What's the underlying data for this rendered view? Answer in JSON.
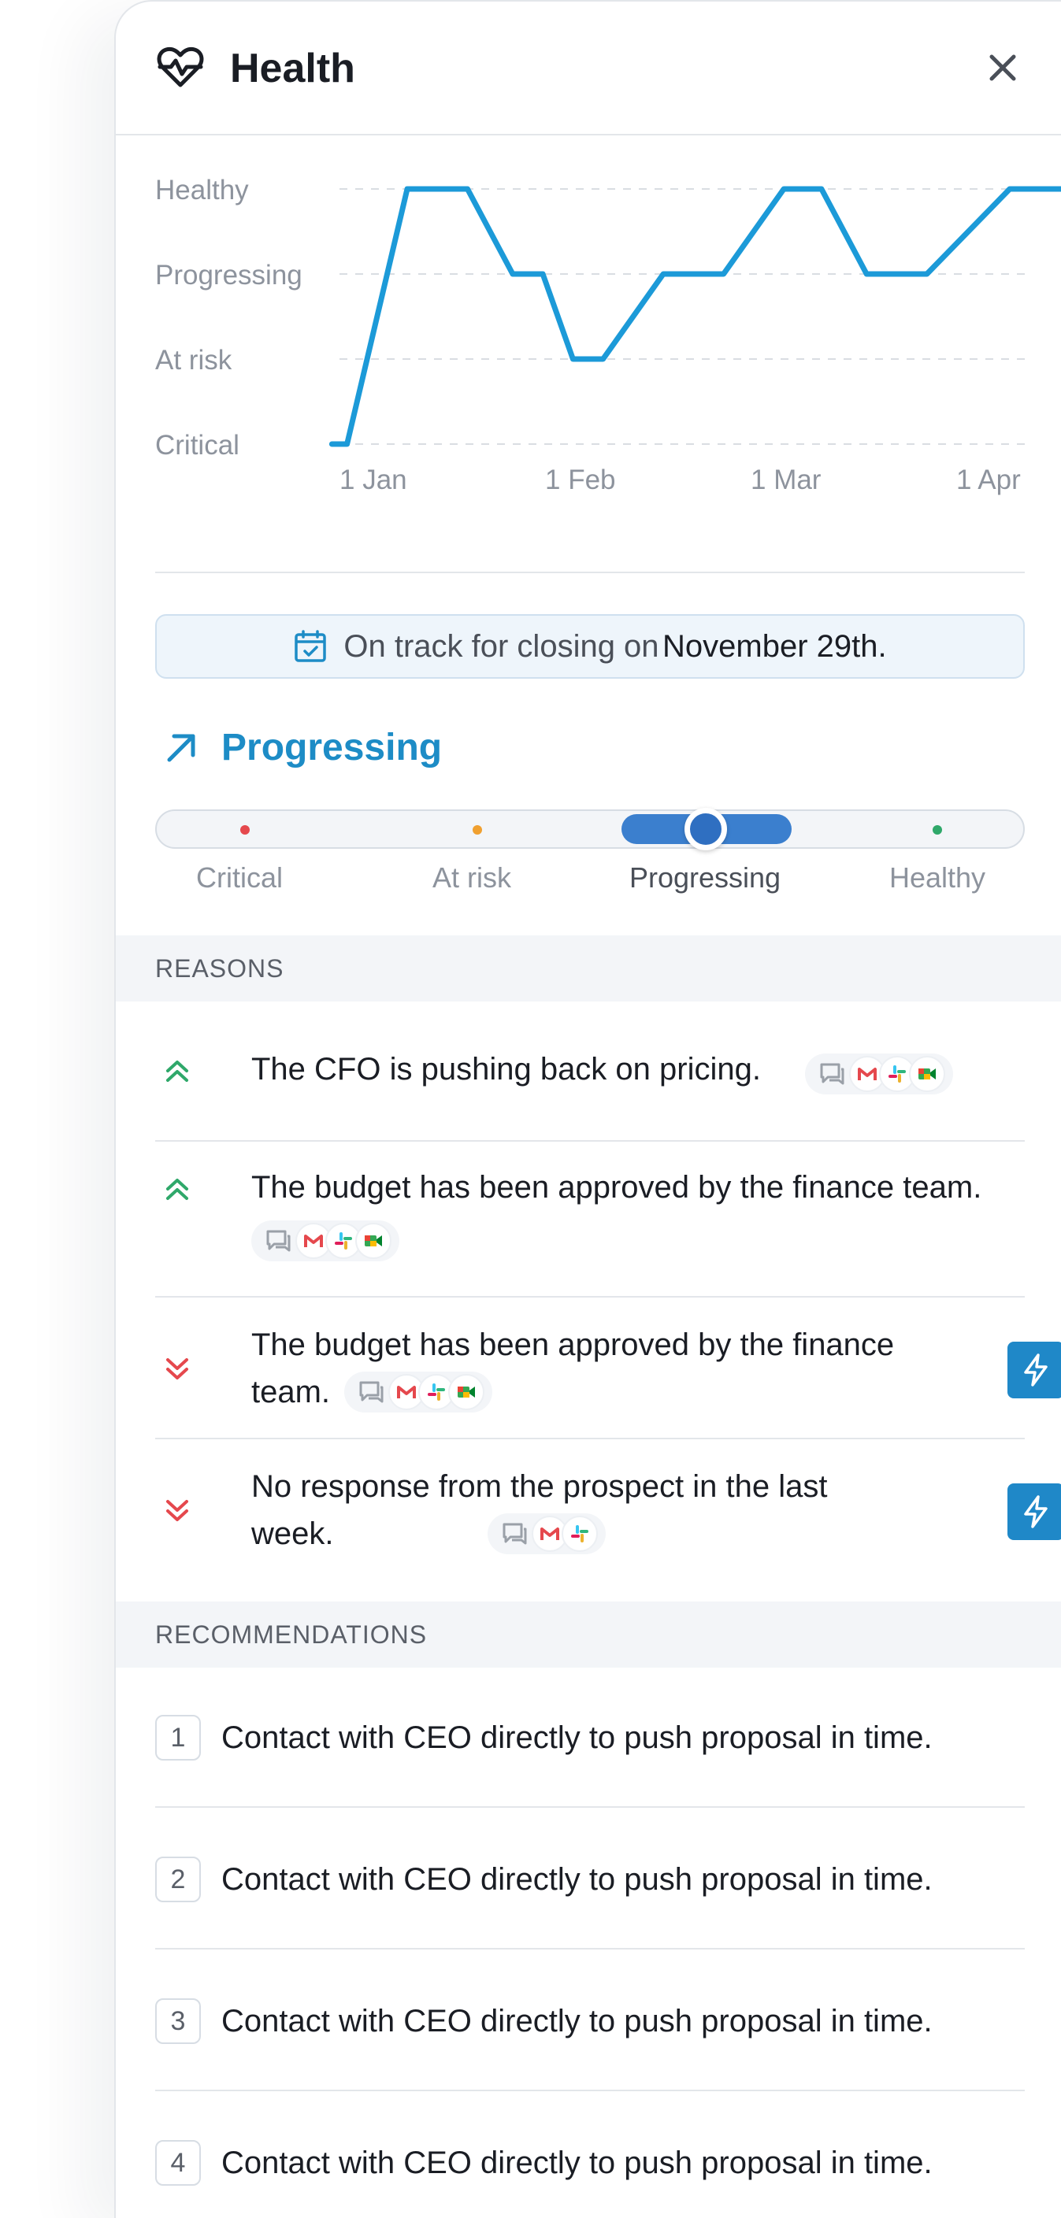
{
  "header": {
    "title": "Health",
    "icon": "heart-pulse-icon"
  },
  "chart_data": {
    "type": "line",
    "title": "",
    "xlabel": "",
    "ylabel": "",
    "y_categories": [
      "Critical",
      "At risk",
      "Progressing",
      "Healthy"
    ],
    "x_ticks": [
      "1 Jan",
      "1 Feb",
      "1 Mar",
      "1 Apr"
    ],
    "grid": true,
    "color": "#1c9ad8",
    "series": [
      {
        "x": [
          "2023-12-31",
          "2024-01-02",
          "2024-01-10",
          "2024-01-18",
          "2024-01-24",
          "2024-01-28",
          "2024-02-01",
          "2024-02-05",
          "2024-02-13",
          "2024-02-21",
          "2024-02-29",
          "2024-03-05",
          "2024-03-11",
          "2024-03-19",
          "2024-03-30",
          "2024-04-09"
        ],
        "y": [
          0,
          0,
          3,
          3,
          2,
          2,
          1,
          1,
          2,
          2,
          3,
          3,
          2,
          2,
          3,
          3
        ]
      }
    ]
  },
  "banner": {
    "text": "On track for closing on",
    "date": "November 29th."
  },
  "status": {
    "label": "Progressing"
  },
  "scale": {
    "labels": [
      "Critical",
      "At risk",
      "Progressing",
      "Healthy"
    ],
    "active": "Progressing",
    "colors": {
      "critical": "#e5484d",
      "at_risk": "#f0a030",
      "healthy": "#2fa86a"
    }
  },
  "reasons": {
    "title": "REASONS",
    "items": [
      {
        "text": "The CFO is pushing back on pricing.",
        "direction": "up"
      },
      {
        "text": "The budget has been approved by the finance team.",
        "direction": "up"
      },
      {
        "text_line1": "The budget has been approved by the finance",
        "text_line2": "team.",
        "direction": "down"
      },
      {
        "text_line1": "No response from the prospect in the last",
        "text_line2": "week.",
        "direction": "down"
      }
    ]
  },
  "recommendations": {
    "title": "RECOMMENDATIONS",
    "items": [
      {
        "num": "1",
        "text": "Contact with CEO directly to push proposal in time."
      },
      {
        "num": "2",
        "text": "Contact with CEO directly to push proposal in time."
      },
      {
        "num": "3",
        "text": "Contact with CEO directly to push proposal in time."
      },
      {
        "num": "4",
        "text": "Contact with CEO directly to push proposal in time."
      }
    ]
  }
}
